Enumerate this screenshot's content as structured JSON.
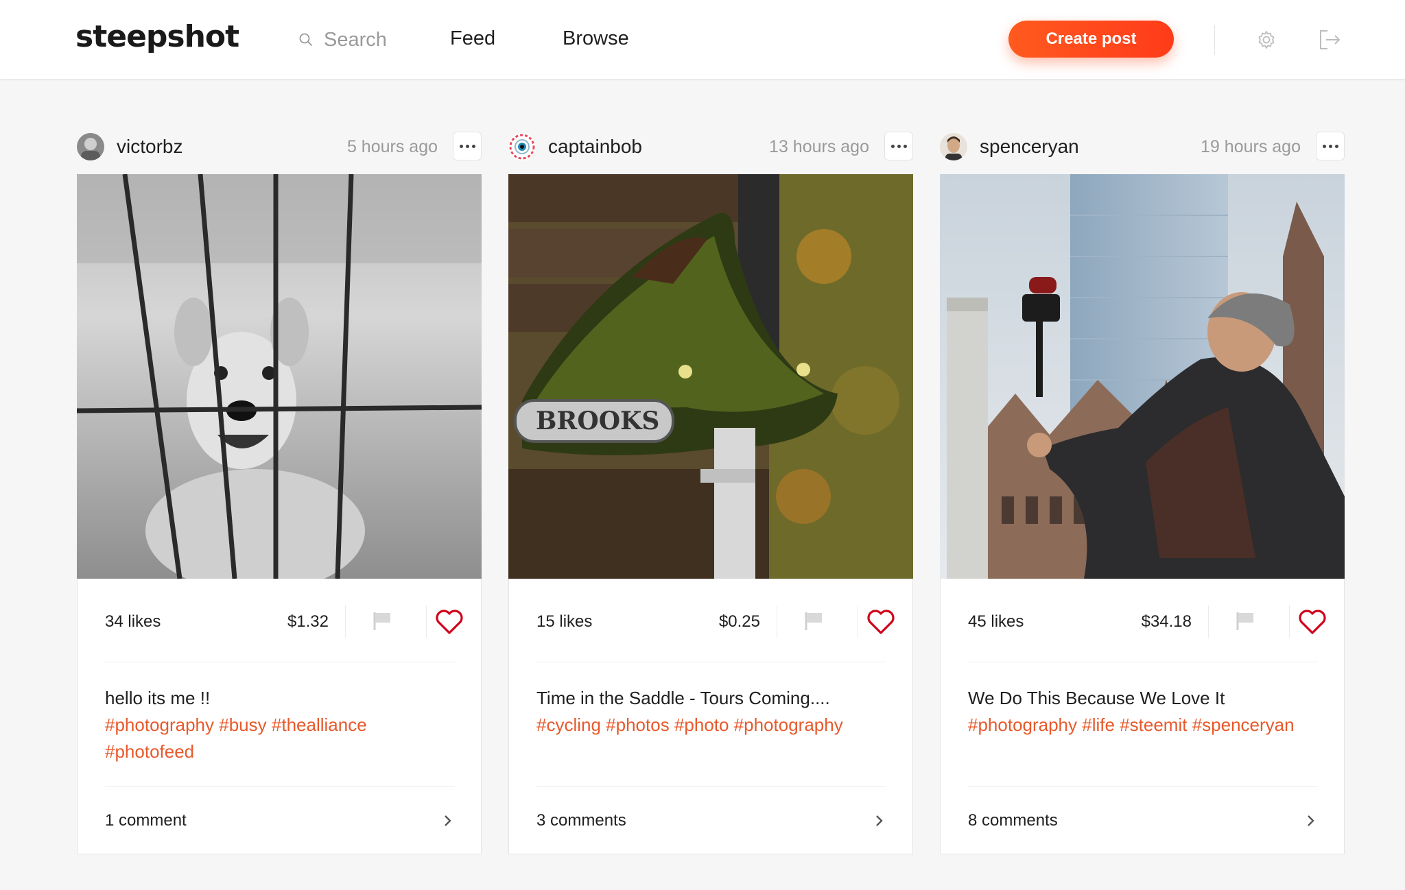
{
  "app": {
    "logo": "steepshot"
  },
  "header": {
    "search_placeholder": "Search",
    "nav": {
      "feed": "Feed",
      "browse": "Browse"
    },
    "create_label": "Create post",
    "settings_icon": "gear-icon",
    "logout_icon": "logout-icon"
  },
  "colors": {
    "accent": "#ff4a1c",
    "tag": "#e8592b",
    "heart": "#d0021b"
  },
  "posts": [
    {
      "user": "victorbz",
      "time": "5 hours ago",
      "likes": "34 likes",
      "payout": "$1.32",
      "text": "hello its me !!",
      "tags": [
        "#photography",
        "#busy",
        "#thealliance",
        "#photofeed"
      ],
      "comments": "1 comment"
    },
    {
      "user": "captainbob",
      "time": "13 hours ago",
      "likes": "15 likes",
      "payout": "$0.25",
      "text": "Time in the Saddle - Tours Coming....",
      "tags": [
        "#cycling",
        "#photos",
        "#photo",
        "#photography"
      ],
      "comments": "3 comments"
    },
    {
      "user": "spenceryan",
      "time": "19 hours ago",
      "likes": "45 likes",
      "payout": "$34.18",
      "text": "We Do This Because We Love It",
      "tags": [
        "#photography",
        "#life",
        "#steemit",
        "#spenceryan"
      ],
      "comments": "8 comments"
    }
  ]
}
